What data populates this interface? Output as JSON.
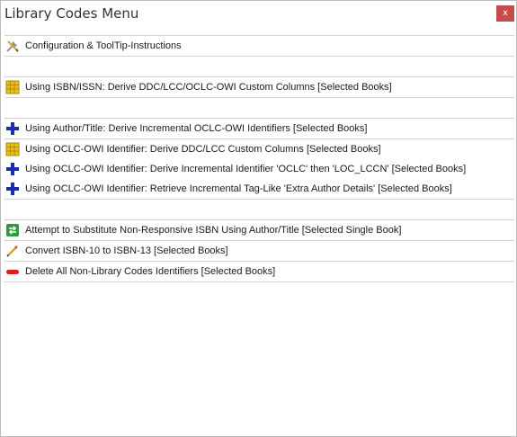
{
  "window": {
    "title": "Library Codes Menu",
    "close_label": "x"
  },
  "menu": {
    "configuration": {
      "label": "Configuration & ToolTip-Instructions",
      "icon": "wrench-pencil-icon"
    },
    "isbn_derive": {
      "label": "Using ISBN/ISSN:  Derive DDC/LCC/OCLC-OWI Custom Columns [Selected Books]",
      "icon": "yellow-grid-icon"
    },
    "author_title_oclc": {
      "label": "Using Author/Title:  Derive Incremental OCLC-OWI Identifiers [Selected Books]",
      "icon": "blue-plus-icon"
    },
    "oclc_ddc_lcc": {
      "label": "Using OCLC-OWI Identifier:  Derive DDC/LCC Custom Columns  [Selected Books]",
      "icon": "yellow-grid-icon"
    },
    "oclc_incremental": {
      "label": "Using OCLC-OWI Identifier:  Derive Incremental Identifier 'OCLC' then 'LOC_LCCN' [Selected Books]",
      "icon": "blue-plus-icon"
    },
    "oclc_extra_author": {
      "label": "Using OCLC-OWI Identifier:  Retrieve Incremental Tag-Like 'Extra Author Details' [Selected Books]",
      "icon": "blue-plus-icon"
    },
    "substitute_isbn": {
      "label": "Attempt to Substitute Non-Responsive ISBN Using Author/Title [Selected Single Book]",
      "icon": "green-swap-icon"
    },
    "convert_isbn": {
      "label": "Convert ISBN-10 to ISBN-13 [Selected Books]",
      "icon": "pencil-icon"
    },
    "delete_identifiers": {
      "label": "Delete All Non-Library Codes Identifiers [Selected Books]",
      "icon": "red-minus-icon"
    }
  },
  "colors": {
    "close_button": "#c74b4b",
    "separator": "#d2d2d2",
    "plus_icon": "#1a2fa8",
    "grid_icon": "#e8c21a",
    "minus_icon": "#d42020",
    "swap_icon": "#2e9a3a"
  }
}
